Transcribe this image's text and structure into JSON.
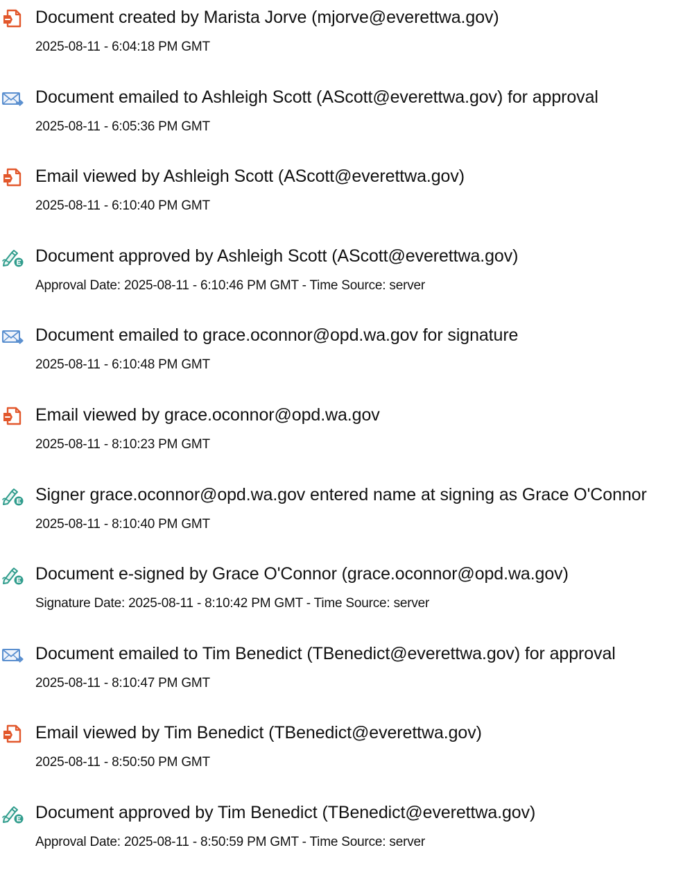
{
  "colors": {
    "document_icon": "#e2572b",
    "email_icon": "#5a8fcf",
    "signature_icon": "#2f9c8c",
    "text": "#111111"
  },
  "events": [
    {
      "icon": "document-icon",
      "title": "Document created by Marista Jorve (mjorve@everettwa.gov)",
      "detail": "2025-08-11 - 6:04:18 PM GMT"
    },
    {
      "icon": "email-icon",
      "title": "Document emailed to Ashleigh Scott (AScott@everettwa.gov) for approval",
      "detail": "2025-08-11 - 6:05:36 PM GMT"
    },
    {
      "icon": "document-icon",
      "title": "Email viewed by Ashleigh Scott (AScott@everettwa.gov)",
      "detail": "2025-08-11 - 6:10:40 PM GMT"
    },
    {
      "icon": "signature-icon",
      "title": "Document approved by Ashleigh Scott (AScott@everettwa.gov)",
      "detail": "Approval Date: 2025-08-11 - 6:10:46 PM GMT - Time Source: server"
    },
    {
      "icon": "email-icon",
      "title": "Document emailed to grace.oconnor@opd.wa.gov for signature",
      "detail": "2025-08-11 - 6:10:48 PM GMT"
    },
    {
      "icon": "document-icon",
      "title": "Email viewed by grace.oconnor@opd.wa.gov",
      "detail": "2025-08-11 - 8:10:23 PM GMT"
    },
    {
      "icon": "signature-icon",
      "title": "Signer grace.oconnor@opd.wa.gov entered name at signing as Grace O'Connor",
      "detail": "2025-08-11 - 8:10:40 PM GMT"
    },
    {
      "icon": "signature-icon",
      "title": "Document e-signed by Grace O'Connor (grace.oconnor@opd.wa.gov)",
      "detail": "Signature Date: 2025-08-11 - 8:10:42 PM GMT - Time Source: server"
    },
    {
      "icon": "email-icon",
      "title": "Document emailed to Tim Benedict (TBenedict@everettwa.gov) for approval",
      "detail": "2025-08-11 - 8:10:47 PM GMT"
    },
    {
      "icon": "document-icon",
      "title": "Email viewed by Tim Benedict (TBenedict@everettwa.gov)",
      "detail": "2025-08-11 - 8:50:50 PM GMT"
    },
    {
      "icon": "signature-icon",
      "title": "Document approved by Tim Benedict (TBenedict@everettwa.gov)",
      "detail": "Approval Date: 2025-08-11 - 8:50:59 PM GMT - Time Source: server"
    }
  ]
}
